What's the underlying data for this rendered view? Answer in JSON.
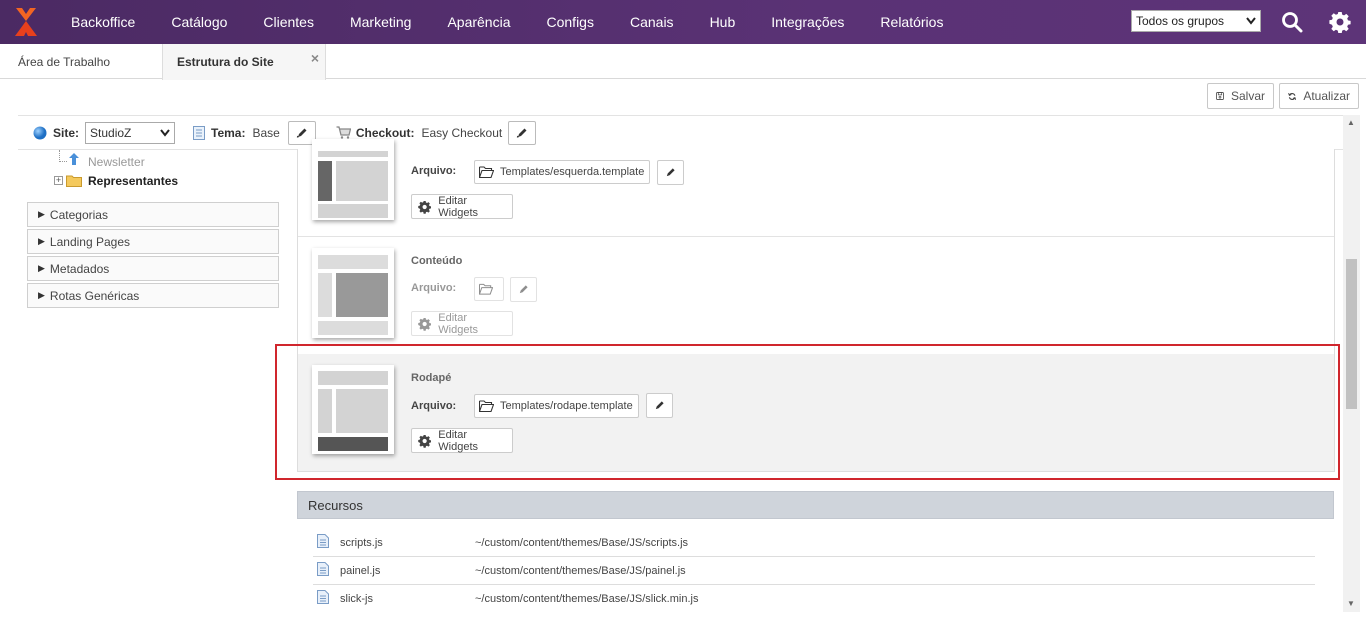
{
  "colors": {
    "nav_bg": "#5a3275",
    "accent_red": "#d0262d",
    "logo_orange": "#f26522"
  },
  "nav": {
    "items": [
      "Backoffice",
      "Catálogo",
      "Clientes",
      "Marketing",
      "Aparência",
      "Configs",
      "Canais",
      "Hub",
      "Integrações",
      "Relatórios"
    ],
    "group_select": "Todos os grupos",
    "icons": [
      "search-icon",
      "gear-icon"
    ]
  },
  "tabs": [
    {
      "label": "Área de Trabalho",
      "active": false
    },
    {
      "label": "Estrutura do Site",
      "active": true,
      "close": "×"
    }
  ],
  "toolbar": {
    "save_label": "Salvar",
    "refresh_label": "Atualizar"
  },
  "sitebar": {
    "site_label": "Site:",
    "site_value": "StudioZ",
    "theme_label": "Tema:",
    "theme_value": "Base",
    "checkout_label": "Checkout:",
    "checkout_value": "Easy Checkout"
  },
  "tree": {
    "items": [
      {
        "label": "Newsletter",
        "muted": true
      },
      {
        "label": "Representantes",
        "bold": true
      }
    ]
  },
  "accordions": [
    "Categorias",
    "Landing Pages",
    "Metadados",
    "Rotas Genéricas"
  ],
  "layouts": [
    {
      "title": "",
      "arquivo_label": "Arquivo:",
      "file": "Templates/esquerda.template",
      "widgets_label": "Editar Widgets",
      "enabled": true
    },
    {
      "title": "Conteúdo",
      "arquivo_label": "Arquivo:",
      "file": "",
      "widgets_label": "Editar Widgets",
      "enabled": false
    },
    {
      "title": "Rodapé",
      "arquivo_label": "Arquivo:",
      "file": "Templates/rodape.template",
      "widgets_label": "Editar Widgets",
      "enabled": true
    }
  ],
  "recursos": {
    "title": "Recursos",
    "rows": [
      {
        "name": "scripts.js",
        "path": "~/custom/content/themes/Base/JS/scripts.js"
      },
      {
        "name": "painel.js",
        "path": "~/custom/content/themes/Base/JS/painel.js"
      },
      {
        "name": "slick-js",
        "path": "~/custom/content/themes/Base/JS/slick.min.js"
      }
    ]
  }
}
